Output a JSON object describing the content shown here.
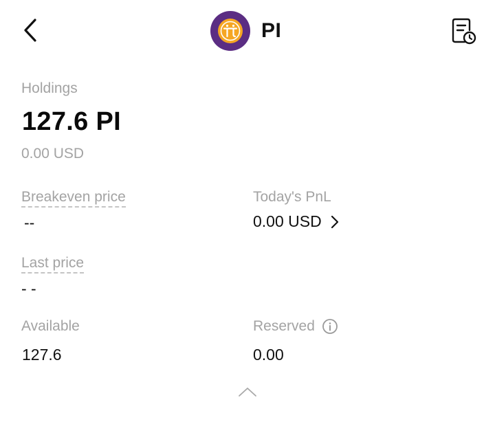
{
  "header": {
    "back_icon": "chevron-left-icon",
    "coin_icon": "pi-coin-logo",
    "coin_symbol": "PI",
    "history_icon": "document-clock-icon",
    "coin_colors": {
      "outer": "#5b2d83",
      "inner": "#f5a623",
      "accent": "#ffffff"
    }
  },
  "holdings": {
    "label": "Holdings",
    "amount": "127.6 PI",
    "usd_value": "0.00 USD"
  },
  "breakeven": {
    "label": "Breakeven price",
    "value": "--"
  },
  "todays_pnl": {
    "label": "Today's PnL",
    "value": "0.00 USD",
    "icon": "chevron-right-icon"
  },
  "last_price": {
    "label": "Last price",
    "value": "- -"
  },
  "available": {
    "label": "Available",
    "value": "127.6"
  },
  "reserved": {
    "label": "Reserved",
    "value": "0.00",
    "icon": "info-icon"
  },
  "collapse": {
    "icon": "chevron-up-icon"
  }
}
